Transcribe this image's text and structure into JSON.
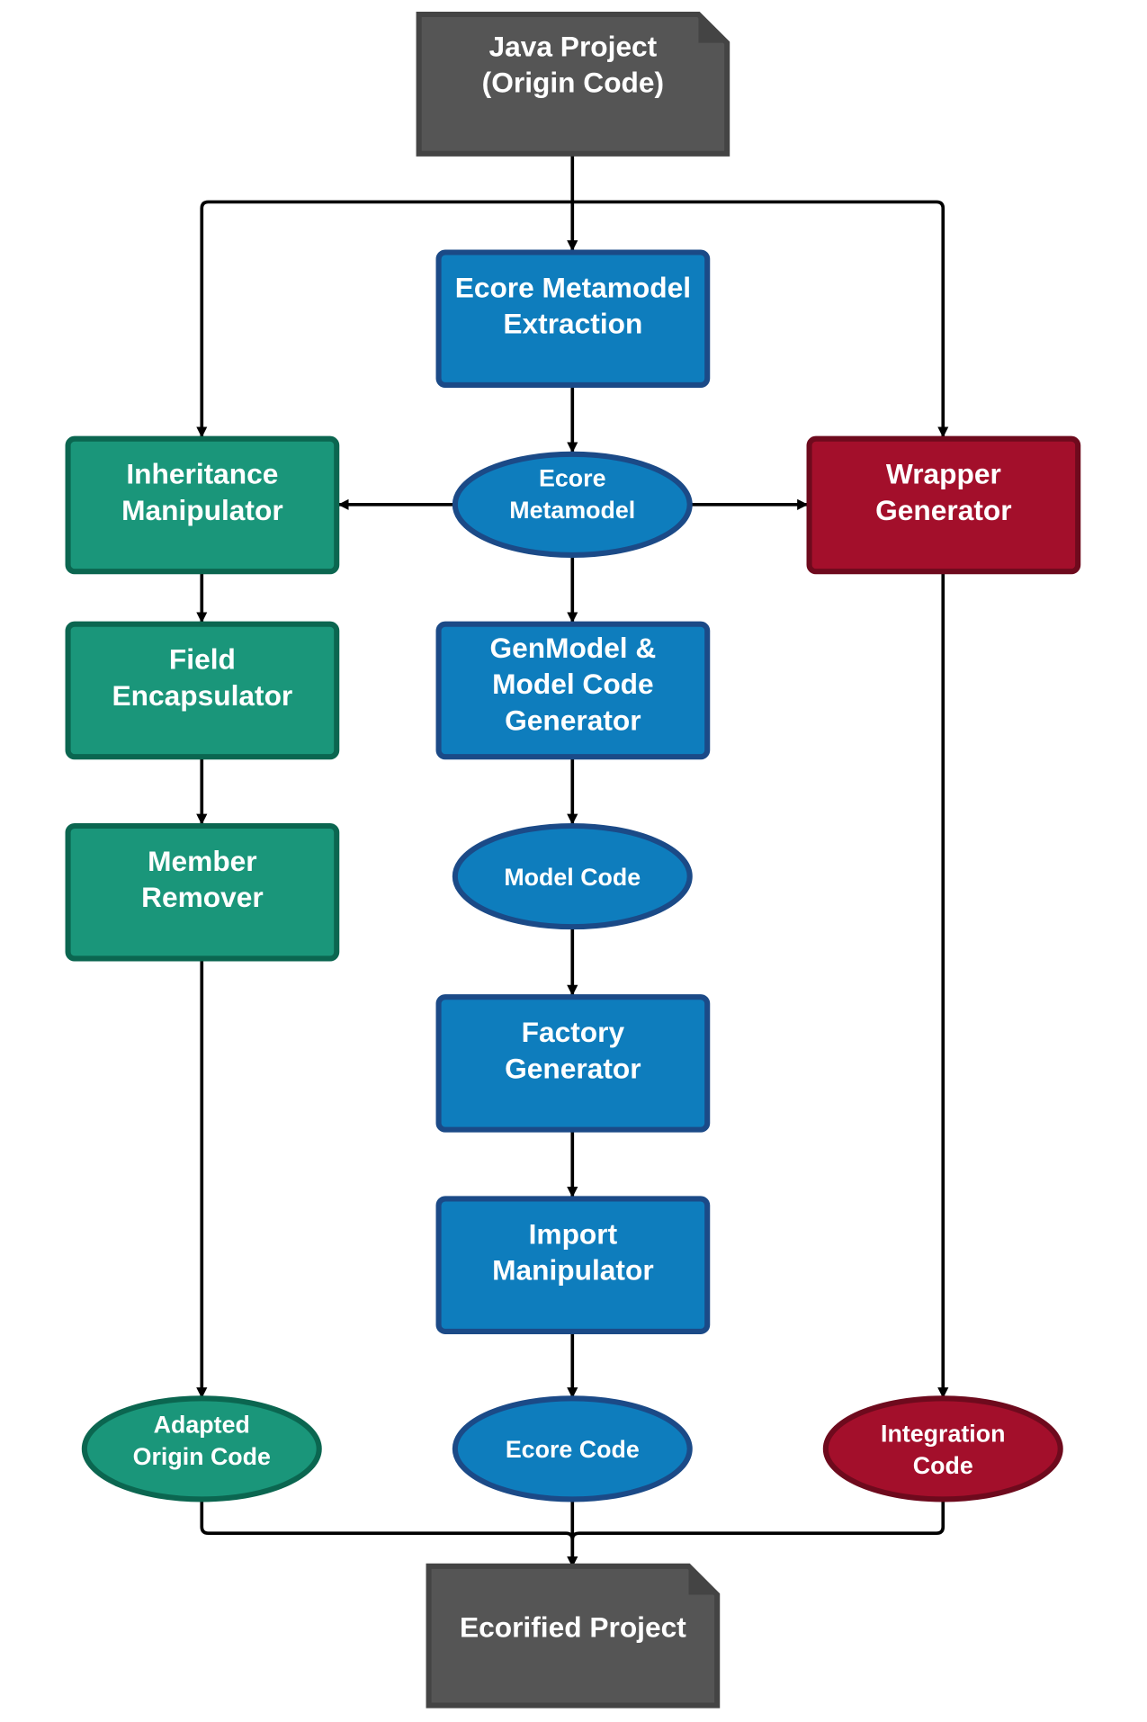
{
  "colors": {
    "green": "#1a967a",
    "green_border": "#0b6650",
    "blue": "#0e7dbd",
    "blue_border": "#1b4a87",
    "red": "#a30f2b",
    "red_border": "#6e0a1d",
    "doc": "#555555",
    "doc_border": "#444444"
  },
  "nodes": {
    "java_project": [
      "Java Project",
      "(Origin Code)"
    ],
    "extraction": [
      "Ecore Metamodel",
      "Extraction"
    ],
    "ecore_metamodel": [
      "Ecore",
      "Metamodel"
    ],
    "inheritance": [
      "Inheritance",
      "Manipulator"
    ],
    "wrapper": [
      "Wrapper",
      "Generator"
    ],
    "field": [
      "Field",
      "Encapsulator"
    ],
    "genmodel": [
      "GenModel &",
      "Model Code",
      "Generator"
    ],
    "member": [
      "Member",
      "Remover"
    ],
    "model_code": [
      "Model Code"
    ],
    "factory": [
      "Factory",
      "Generator"
    ],
    "import": [
      "Import",
      "Manipulator"
    ],
    "adapted": [
      "Adapted",
      "Origin Code"
    ],
    "ecore_code": [
      "Ecore Code"
    ],
    "integration": [
      "Integration",
      "Code"
    ],
    "ecorified": [
      "Ecorified Project"
    ]
  }
}
